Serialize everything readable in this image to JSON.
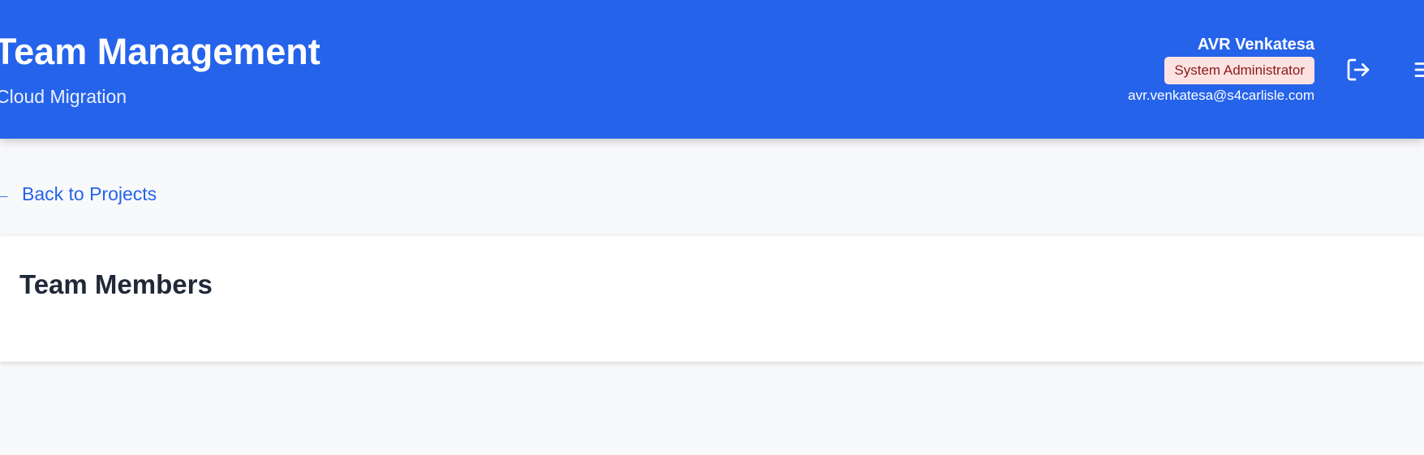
{
  "header": {
    "title": "Team Management",
    "subtitle": "Cloud Migration",
    "user": {
      "name": "AVR Venkatesa",
      "role": "System Administrator",
      "email": "avr.venkatesa@s4carlisle.com"
    },
    "logout_icon": "logout-icon",
    "menu_icon": "hamburger-menu-icon"
  },
  "nav": {
    "back_arrow": "←",
    "back_label": "Back to Projects"
  },
  "card": {
    "title": "Team Members"
  },
  "colors": {
    "header_bg": "#2563eb",
    "page_bg": "#f8f9fb",
    "link": "#2563eb",
    "badge_bg": "#fde2e2",
    "badge_text": "#8b1a1a",
    "heading": "#1f2937"
  }
}
